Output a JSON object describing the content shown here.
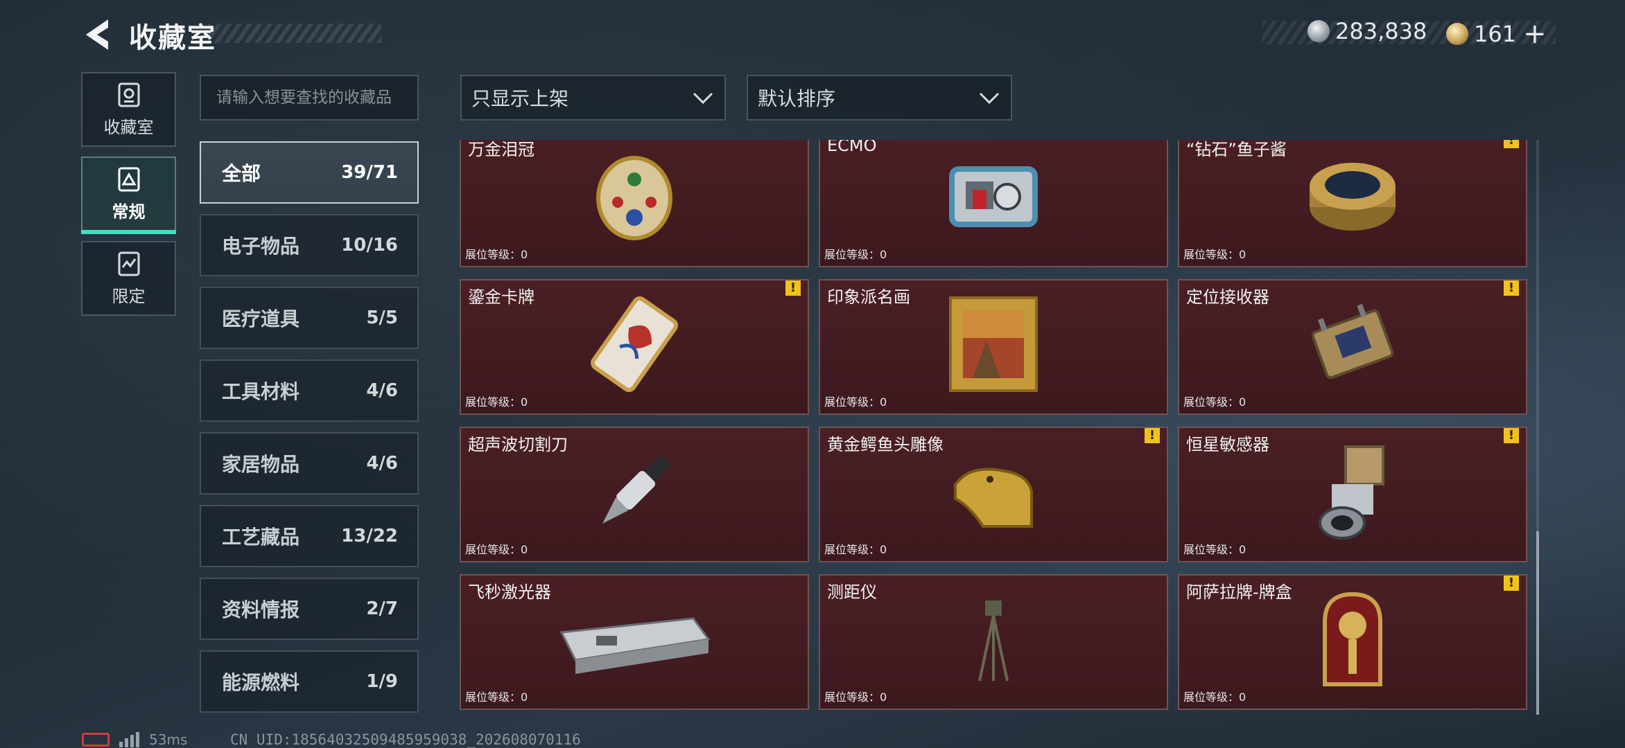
{
  "header": {
    "title": "收藏室",
    "currencies": [
      {
        "icon": "silver-coin-icon",
        "value": "283,838"
      },
      {
        "icon": "gold-token-icon",
        "value": "161",
        "add": "+"
      }
    ]
  },
  "side_tabs": [
    {
      "label": "收藏室",
      "icon": "collection-room-icon",
      "active": false
    },
    {
      "label": "常规",
      "icon": "regular-icon",
      "active": true
    },
    {
      "label": "限定",
      "icon": "limited-icon",
      "active": false
    }
  ],
  "search": {
    "placeholder": "请输入想要查找的收藏品"
  },
  "filters": {
    "shelf_filter": "只显示上架",
    "sort": "默认排序"
  },
  "categories": [
    {
      "name": "全部",
      "count": "39/71",
      "active": true
    },
    {
      "name": "电子物品",
      "count": "10/16"
    },
    {
      "name": "医疗道具",
      "count": "5/5"
    },
    {
      "name": "工具材料",
      "count": "4/6"
    },
    {
      "name": "家居物品",
      "count": "4/6"
    },
    {
      "name": "工艺藏品",
      "count": "13/22"
    },
    {
      "name": "资料情报",
      "count": "2/7"
    },
    {
      "name": "能源燃料",
      "count": "1/9"
    }
  ],
  "items": [
    {
      "name": "万金泪冠",
      "level": "展位等级：0",
      "warn": false
    },
    {
      "name": "ECMO",
      "level": "展位等级：0",
      "warn": false
    },
    {
      "name": "“钻石”鱼子酱",
      "level": "展位等级：0",
      "warn": true
    },
    {
      "name": "鎏金卡牌",
      "level": "展位等级：0",
      "warn": true
    },
    {
      "name": "印象派名画",
      "level": "展位等级：0",
      "warn": false
    },
    {
      "name": "定位接收器",
      "level": "展位等级：0",
      "warn": true
    },
    {
      "name": "超声波切割刀",
      "level": "展位等级：0",
      "warn": false
    },
    {
      "name": "黄金鳄鱼头雕像",
      "level": "展位等级：0",
      "warn": true
    },
    {
      "name": "恒星敏感器",
      "level": "展位等级：0",
      "warn": true
    },
    {
      "name": "飞秒激光器",
      "level": "展位等级：0",
      "warn": false
    },
    {
      "name": "测距仪",
      "level": "展位等级：0",
      "warn": false
    },
    {
      "name": "阿萨拉牌-牌盒",
      "level": "展位等级：0",
      "warn": true
    }
  ],
  "warn_symbol": "!",
  "footer": {
    "ping": "53ms",
    "uid": "CN UID:18564032509485959038_202608070116"
  },
  "colors": {
    "accent": "#3fe0c0",
    "card_bg": "#441d22",
    "warn": "#f1c21b",
    "ping_low_battery": "#d23a3a"
  }
}
